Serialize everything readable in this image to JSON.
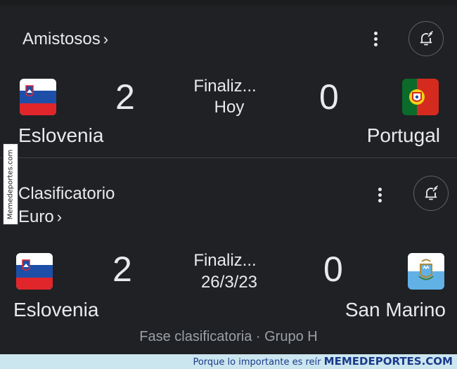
{
  "matches": [
    {
      "competition": "Amistosos",
      "chevron": "›",
      "home": {
        "name": "Eslovenia",
        "flag": "slovenia-flag",
        "score": "2"
      },
      "away": {
        "name": "Portugal",
        "flag": "portugal-flag",
        "score": "0"
      },
      "status": "Finaliz...",
      "date": "Hoy",
      "footer": ""
    },
    {
      "competition_line1": "Clasificatorio",
      "competition_line2": "Euro",
      "chevron": "›",
      "home": {
        "name": "Eslovenia",
        "flag": "slovenia-flag",
        "score": "2"
      },
      "away": {
        "name": "San Marino",
        "flag": "san-marino-flag",
        "score": "0"
      },
      "status": "Finaliz...",
      "date": "26/3/23",
      "footer": "Fase clasificatoria · Grupo H"
    }
  ],
  "icons": {
    "more": "more-vert-icon",
    "notify": "bell-add-icon"
  },
  "watermark": {
    "side": "Memedeportes.com",
    "bottom_prefix": "Porque lo importante es reír",
    "bottom_brand": "MEMEDEPORTES.COM"
  },
  "colors": {
    "background": "#202124",
    "text": "#e8eaed",
    "muted": "#9aa0a6",
    "divider": "#3c4043"
  }
}
